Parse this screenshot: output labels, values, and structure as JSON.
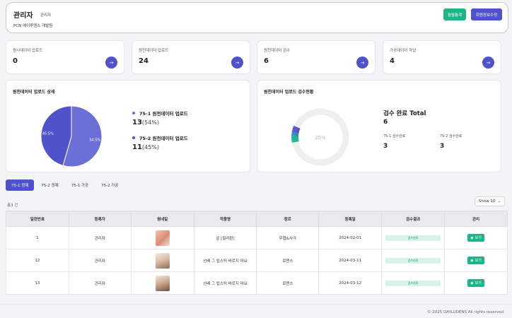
{
  "header": {
    "name": "관리자",
    "role": "관리자",
    "team": "PCN 에이루덴스 개발팀",
    "btn_stats": "월별통계",
    "btn_edit": "회원정보수정"
  },
  "stats": [
    {
      "label": "원시데이터 업로드",
      "value": "0"
    },
    {
      "label": "원천데이터 업로드",
      "value": "24"
    },
    {
      "label": "원천데이터 검수",
      "value": "6"
    },
    {
      "label": "가공데이터 작업",
      "value": "4"
    }
  ],
  "arrow_glyph": "→",
  "upload_panel": {
    "title": "원천데이터 업로드 상세",
    "items": [
      {
        "label": "75-1 원천데이터 업로드",
        "count": "13",
        "pct": "(54%)",
        "color": "#6c6fd6"
      },
      {
        "label": "75-2 원천데이터 업로드",
        "count": "11",
        "pct": "(45%)",
        "color": "#4f52c8"
      }
    ]
  },
  "chart_data": [
    {
      "type": "pie",
      "categories": [
        "75-1 원천데이터 업로드",
        "75-2 원천데이터 업로드"
      ],
      "values": [
        54.5,
        45.5
      ],
      "labels": [
        "54.5%",
        "45.5%"
      ],
      "colors": [
        "#6c6fd6",
        "#4f52c8"
      ]
    },
    {
      "type": "gauge",
      "value": 25,
      "label": "25%"
    }
  ],
  "review_panel": {
    "title": "원천데이터 업로드 검수현황",
    "total_label": "검수 완료 Total",
    "total_value": "6",
    "sub": [
      {
        "label": "75-1 검수완료",
        "value": "3"
      },
      {
        "label": "75-2 검수완료",
        "value": "3"
      }
    ]
  },
  "tabs": [
    "75-1 정제",
    "75-2 정제",
    "75-1 가공",
    "75-2 가공"
  ],
  "total_text": "총3 건",
  "show_label": "Show 10",
  "table": {
    "headers": [
      "일련번호",
      "등록자",
      "썸네일",
      "작품명",
      "장르",
      "등록일",
      "검수결과",
      "관리"
    ],
    "rows": [
      {
        "id": "1",
        "user": "관리자",
        "title": "궁 [컬러판]",
        "genre": "무협&사극",
        "date": "2024-02-01",
        "result": "검수완료",
        "action": "보기"
      },
      {
        "id": "12",
        "user": "관리자",
        "title": "선배 그 립스틱 바르지 마요",
        "genre": "로맨스",
        "date": "2024-03-11",
        "result": "검수완료",
        "action": "보기"
      },
      {
        "id": "13",
        "user": "관리자",
        "title": "선배 그 립스틱 바르지 마요",
        "genre": "로맨스",
        "date": "2024-03-12",
        "result": "검수완료",
        "action": "보기"
      }
    ]
  },
  "footer": "© 2025 DAYLUDENS All rights reserved"
}
